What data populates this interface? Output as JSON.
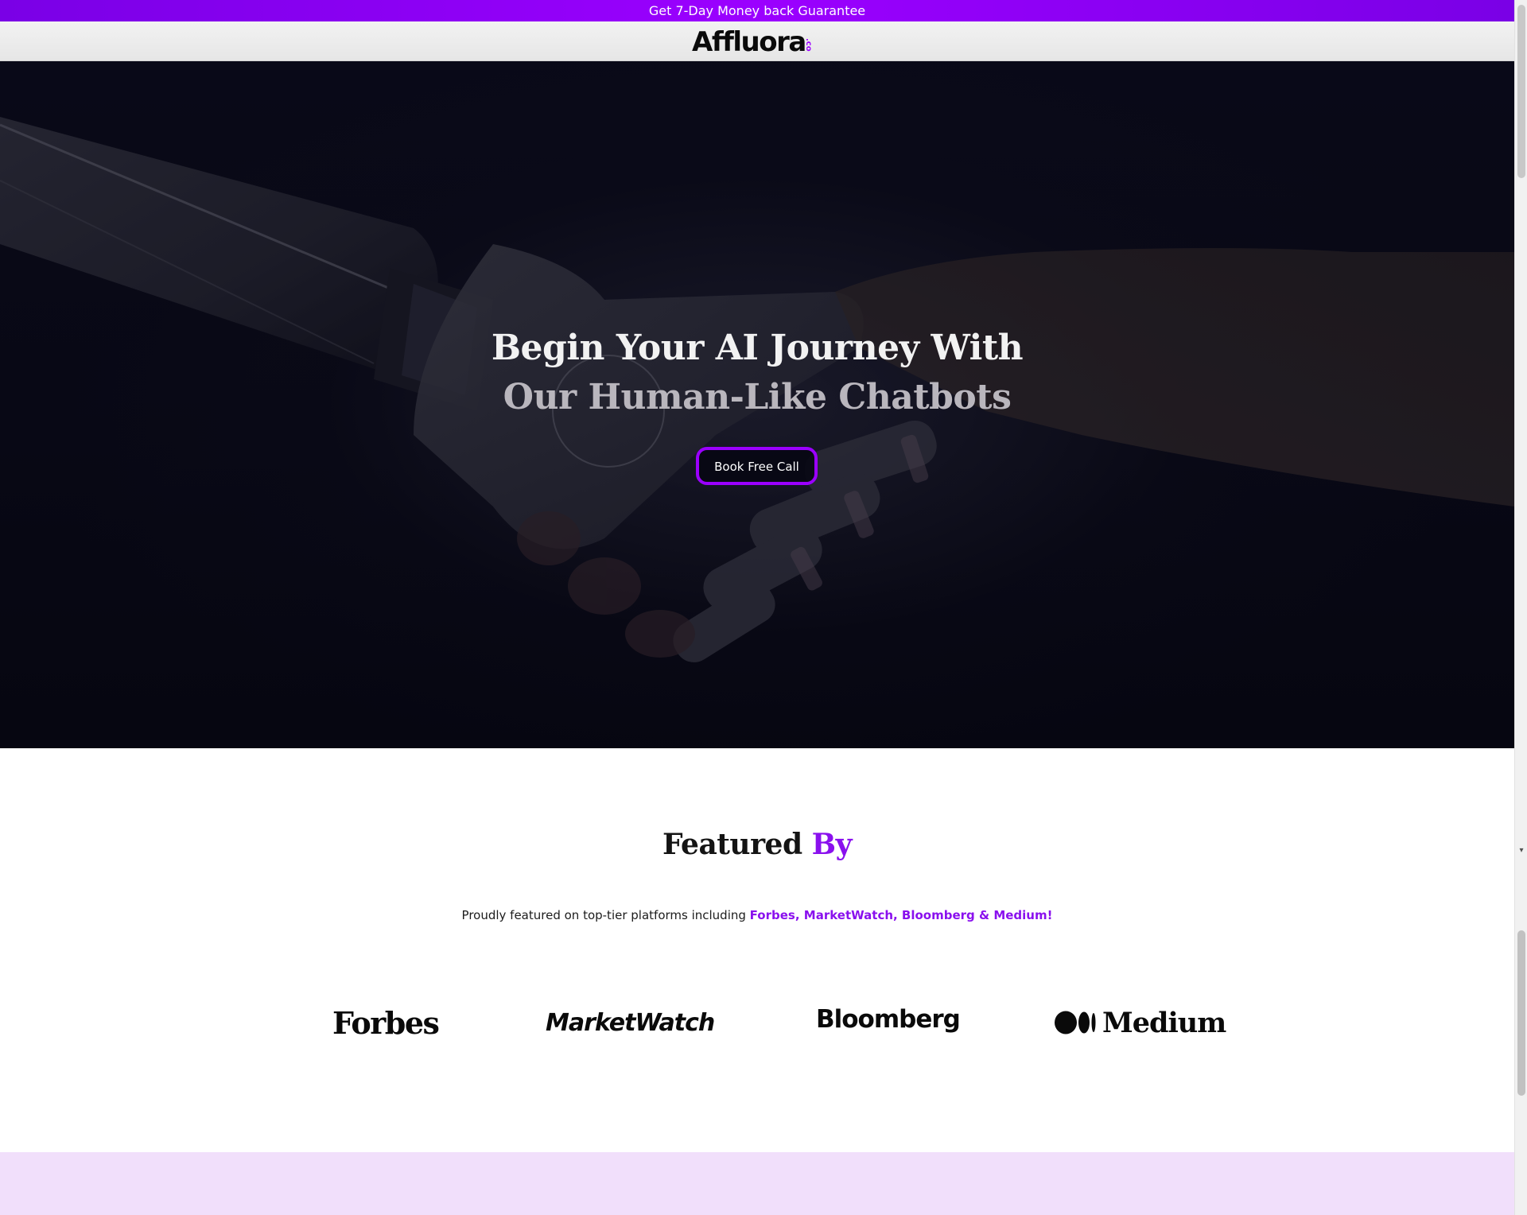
{
  "promo": {
    "text": "Get 7-Day Money back Guarantee"
  },
  "header": {
    "logo_text": "Affluora",
    "logo_suffix": ".co"
  },
  "hero": {
    "title_line1": "Begin Your AI Journey With",
    "title_line2": "Our Human-Like Chatbots",
    "cta_label": "Book Free Call"
  },
  "featured": {
    "title_main": "Featured ",
    "title_accent": "By",
    "subtitle_prefix": "Proudly featured on top-tier platforms including ",
    "subtitle_highlight": "Forbes, MarketWatch, Bloomberg & Medium!",
    "logos": [
      "Forbes",
      "MarketWatch",
      "Bloomberg",
      "Medium"
    ]
  },
  "colors": {
    "accent": "#9b00ff",
    "accent_text": "#8a10ee",
    "hero_bg": "#0a0a17",
    "band": "#f1dffb"
  }
}
